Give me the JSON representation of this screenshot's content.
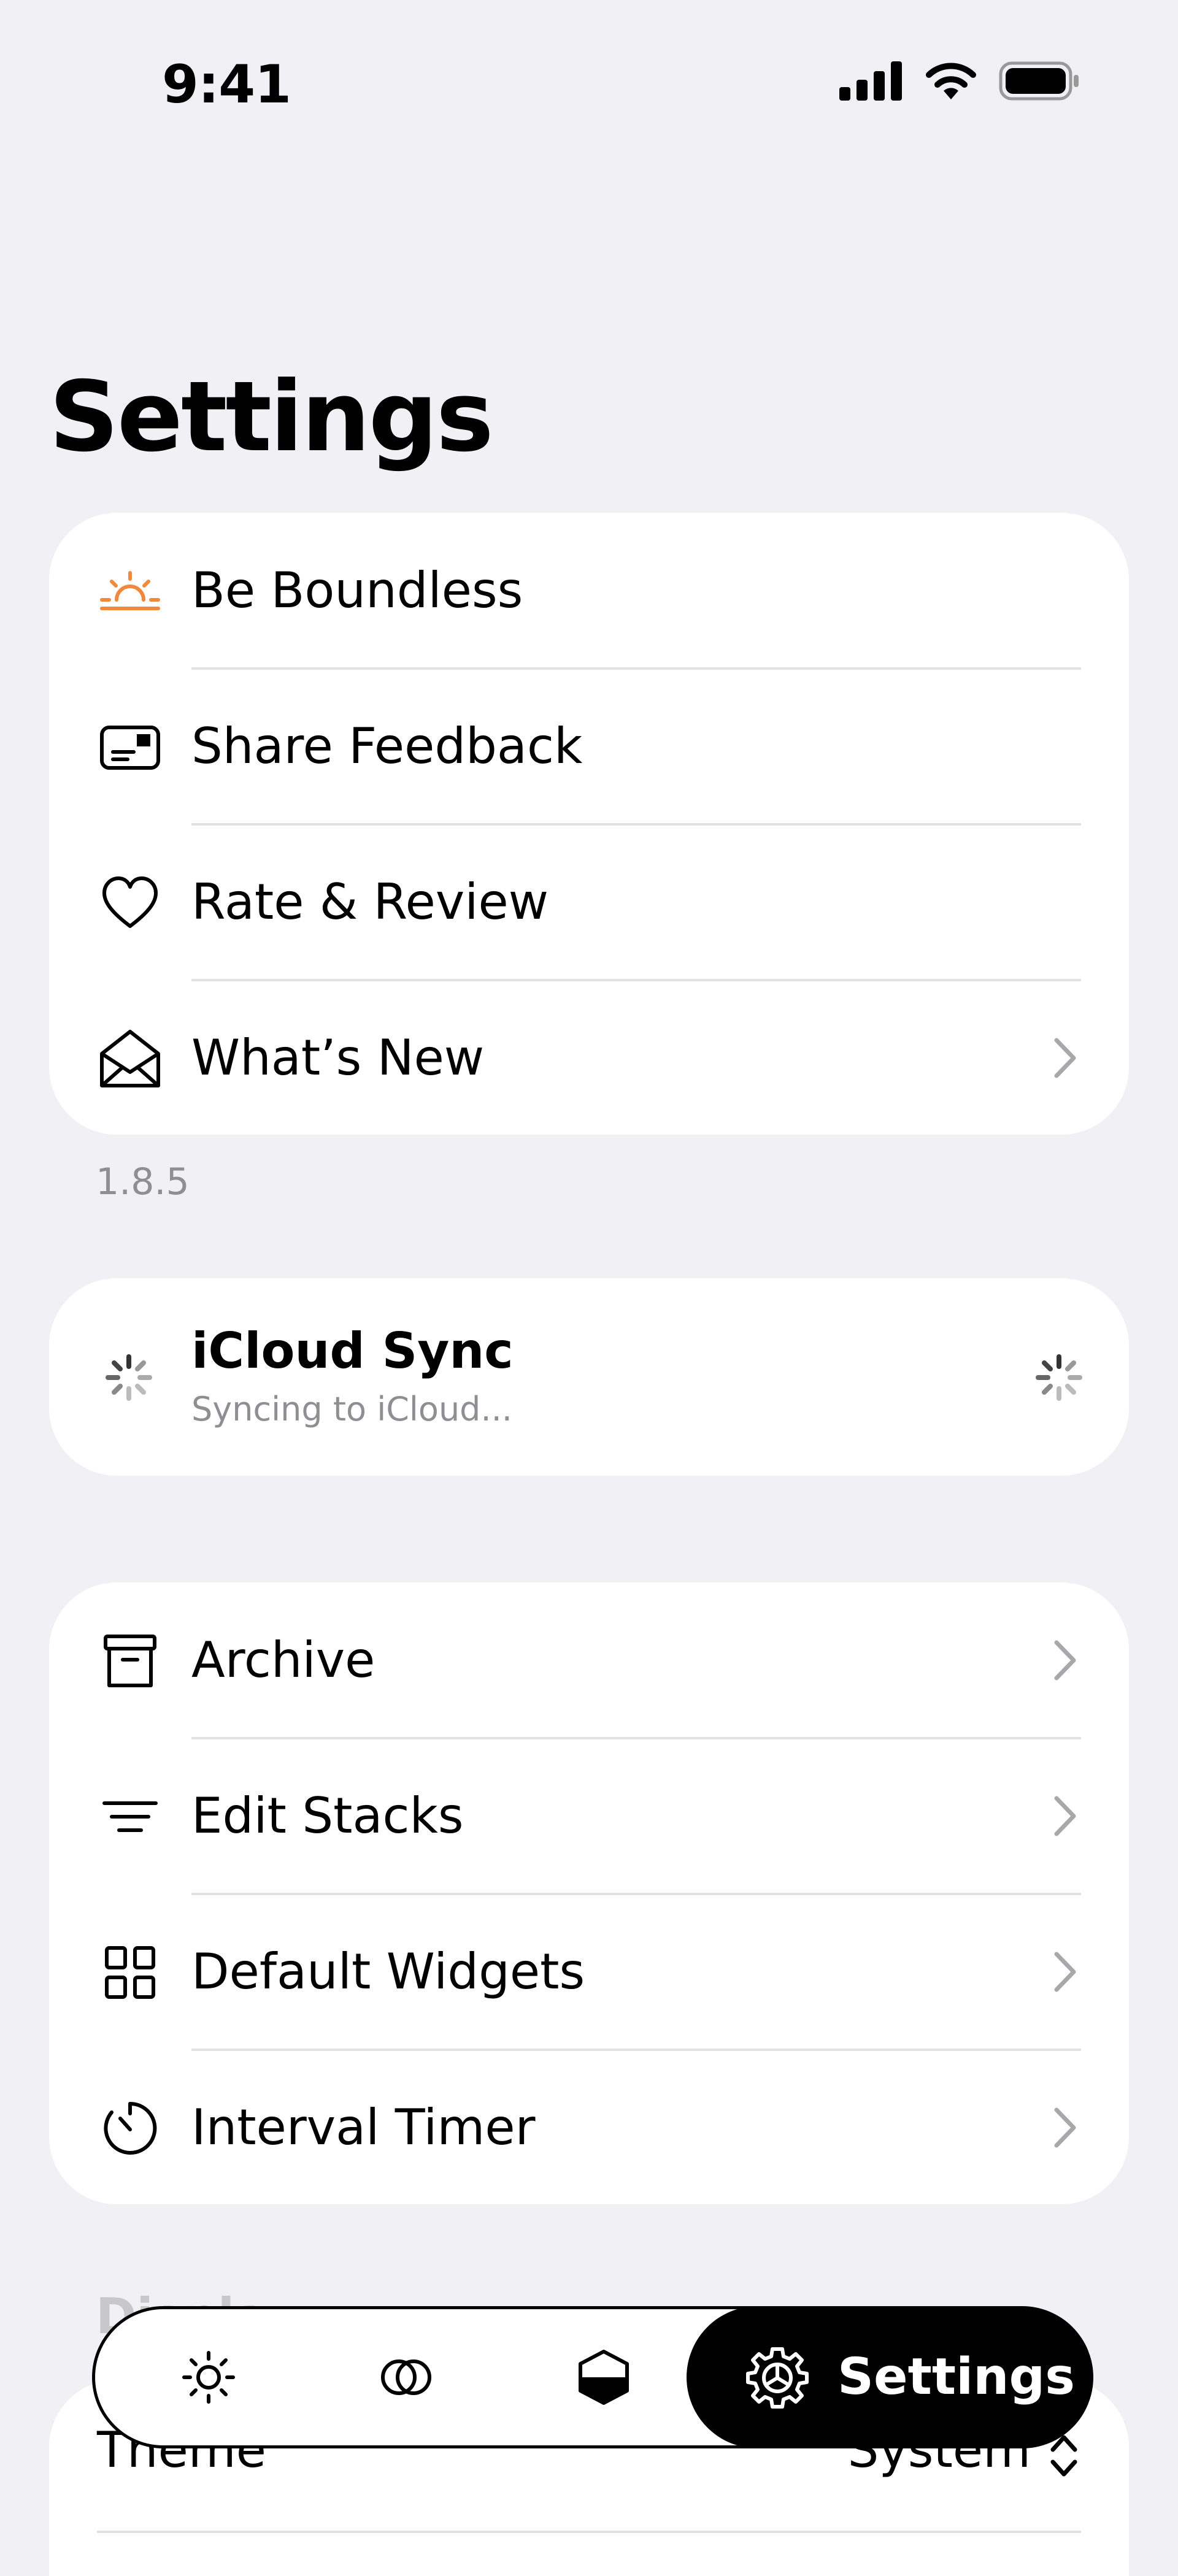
{
  "status_bar": {
    "time": "9:41",
    "icons": [
      "cellular-signal-icon",
      "wifi-icon",
      "battery-icon"
    ]
  },
  "title": "Settings",
  "group1": {
    "items": [
      {
        "label": "Be Boundless",
        "icon": "sunrise-icon",
        "icon_color": "#f0883e"
      },
      {
        "label": "Share Feedback",
        "icon": "feedback-card-icon"
      },
      {
        "label": "Rate & Review",
        "icon": "heart-icon"
      },
      {
        "label": "What’s New",
        "icon": "envelope-open-icon",
        "chevron": true
      }
    ]
  },
  "version": "1.8.5",
  "sync": {
    "title": "iCloud Sync",
    "subtitle": "Syncing to iCloud..."
  },
  "group3": {
    "items": [
      {
        "label": "Archive",
        "icon": "archive-box-icon"
      },
      {
        "label": "Edit Stacks",
        "icon": "lines-icon"
      },
      {
        "label": "Default Widgets",
        "icon": "widgets-grid-icon"
      },
      {
        "label": "Interval Timer",
        "icon": "timer-icon"
      }
    ]
  },
  "display": {
    "header": "Display",
    "theme_label": "Theme",
    "theme_value": "System"
  },
  "tab_bar": {
    "tabs": [
      {
        "icon": "sun-icon"
      },
      {
        "icon": "overlapping-circles-icon"
      },
      {
        "icon": "half-filled-hexagon-icon"
      }
    ],
    "active_label": "Settings",
    "active_icon": "gear-icon"
  },
  "colors": {
    "background": "#f1f0f5",
    "card": "#ffffff",
    "accent": "#f0883e",
    "secondary_text": "#8e8e93"
  }
}
